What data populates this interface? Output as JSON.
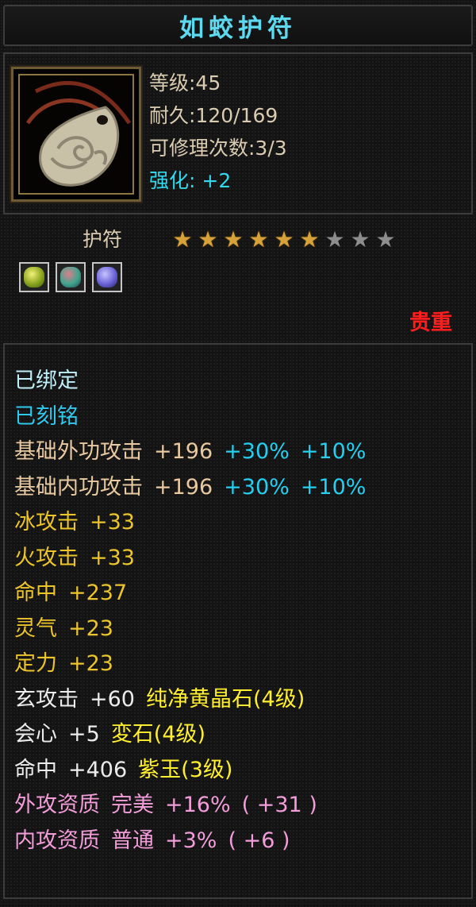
{
  "title": "如蛟护符",
  "stats": {
    "level": "等级:45",
    "durability": "耐久:120/169",
    "repairs": "可修理次数:3/3",
    "enhance": "强化: +2"
  },
  "type_label": "护符",
  "stars": {
    "filled": 6,
    "total": 9
  },
  "gems": [
    {
      "name": "yellow-gem-icon",
      "color": "#c8d23a"
    },
    {
      "name": "mixed-gem-icon",
      "color": "#3fa58f"
    },
    {
      "name": "purple-gem-icon",
      "color": "#6a63d8"
    }
  ],
  "rarity": "贵重",
  "attributes": {
    "bound": "已绑定",
    "engraved": "已刻铭",
    "ext_attack": {
      "name": "基础外功攻击",
      "value": "+196",
      "pct1": "+30%",
      "pct2": "+10%"
    },
    "int_attack": {
      "name": "基础内功攻击",
      "value": "+196",
      "pct1": "+30%",
      "pct2": "+10%"
    },
    "ice": {
      "name": "冰攻击",
      "value": "+33"
    },
    "fire": {
      "name": "火攻击",
      "value": "+33"
    },
    "hit": {
      "name": "命中",
      "value": "+237"
    },
    "spirit": {
      "name": "灵气",
      "value": "+23"
    },
    "focus": {
      "name": "定力",
      "value": "+23"
    },
    "mystic": {
      "name": "玄攻击",
      "value": "+60",
      "gem": "纯净黄晶石(4级)"
    },
    "crit": {
      "name": "会心",
      "value": "+5",
      "gem": "変石(4级)"
    },
    "hit2": {
      "name": "命中",
      "value": "+406",
      "gem": "紫玉(3级)"
    },
    "ext_quality": {
      "name": "外攻资质",
      "grade": "完美",
      "pct": "+16%",
      "bonus": "( +31 )"
    },
    "int_quality": {
      "name": "内攻资质",
      "grade": "普通",
      "pct": "+3%",
      "bonus": "( +6 )"
    }
  }
}
